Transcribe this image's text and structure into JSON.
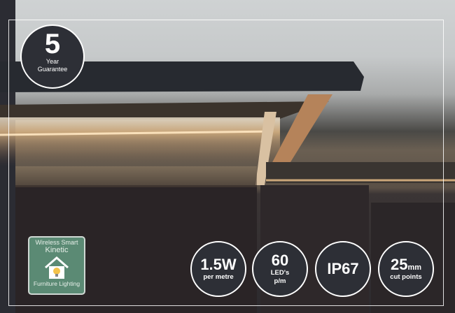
{
  "guarantee": {
    "number": "5",
    "line1": "Year",
    "line2": "Guarantee"
  },
  "logo": {
    "line1": "Wireless Smart",
    "line2": "Kinetic",
    "line3": "Furniture Lighting",
    "icon": "smart-home-bulb-icon"
  },
  "specs": [
    {
      "value": "1.5W",
      "unit": "",
      "sub1": "per metre",
      "sub2": ""
    },
    {
      "value": "60",
      "unit": "",
      "sub1": "LED's",
      "sub2": "p/m"
    },
    {
      "value": "IP67",
      "unit": "",
      "sub1": "",
      "sub2": ""
    },
    {
      "value": "25",
      "unit": "mm",
      "sub1": "cut points",
      "sub2": ""
    }
  ],
  "colors": {
    "badge": "#2d2f36",
    "logo": "#5b8a74",
    "led_glow": "#f3c68a"
  }
}
